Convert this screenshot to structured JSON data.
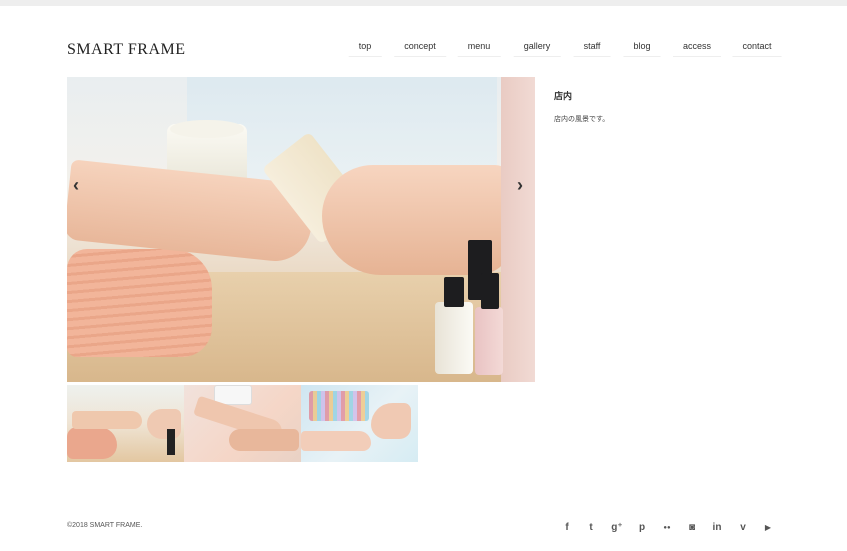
{
  "site": {
    "logo": "SMART FRAME"
  },
  "nav": {
    "items": [
      {
        "label": "top"
      },
      {
        "label": "concept"
      },
      {
        "label": "menu"
      },
      {
        "label": "gallery"
      },
      {
        "label": "staff"
      },
      {
        "label": "blog"
      },
      {
        "label": "access"
      },
      {
        "label": "contact"
      }
    ]
  },
  "slider": {
    "prev_icon": "chevron-left-icon",
    "next_icon": "chevron-right-icon",
    "prev_glyph": "‹",
    "next_glyph": "›",
    "thumbnails": [
      {
        "subject": "nail-buffing-thumbnail"
      },
      {
        "subject": "nail-lamp-thumbnail"
      },
      {
        "subject": "nail-polish-shelf-thumbnail"
      }
    ]
  },
  "sidebar": {
    "title": "店内",
    "description": "店内の風景です。"
  },
  "footer": {
    "copyright": "©2018 SMART FRAME.",
    "social": [
      {
        "icon": "facebook-icon",
        "glyph": "f"
      },
      {
        "icon": "twitter-icon",
        "glyph": "t"
      },
      {
        "icon": "google-plus-icon",
        "glyph": "g⁺"
      },
      {
        "icon": "pinterest-icon",
        "glyph": "p"
      },
      {
        "icon": "flickr-icon",
        "glyph": "●●"
      },
      {
        "icon": "instagram-icon",
        "glyph": "◙"
      },
      {
        "icon": "linkedin-icon",
        "glyph": "in"
      },
      {
        "icon": "vimeo-icon",
        "glyph": "v"
      },
      {
        "icon": "youtube-icon",
        "glyph": "▶"
      }
    ]
  },
  "colors": {
    "text": "#333333",
    "background": "#ffffff",
    "topbar": "#eeeeee"
  }
}
